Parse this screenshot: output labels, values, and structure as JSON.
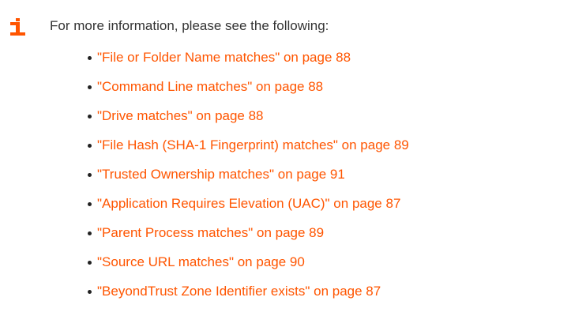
{
  "note": {
    "icon": "info-icon",
    "accent_color": "#ff5500",
    "intro": "For more information, please see the following:",
    "links": [
      {
        "text": "\"File or Folder Name matches\" on page 88"
      },
      {
        "text": "\"Command Line matches\" on page 88"
      },
      {
        "text": "\"Drive matches\" on page 88"
      },
      {
        "text": "\"File Hash (SHA-1 Fingerprint) matches\" on page 89"
      },
      {
        "text": "\"Trusted Ownership matches\" on page 91"
      },
      {
        "text": "\"Application Requires Elevation (UAC)\" on page 87"
      },
      {
        "text": "\"Parent Process matches\" on page 89"
      },
      {
        "text": "\"Source URL matches\" on page 90"
      },
      {
        "text": "\"BeyondTrust Zone Identifier exists\" on page 87"
      }
    ]
  }
}
